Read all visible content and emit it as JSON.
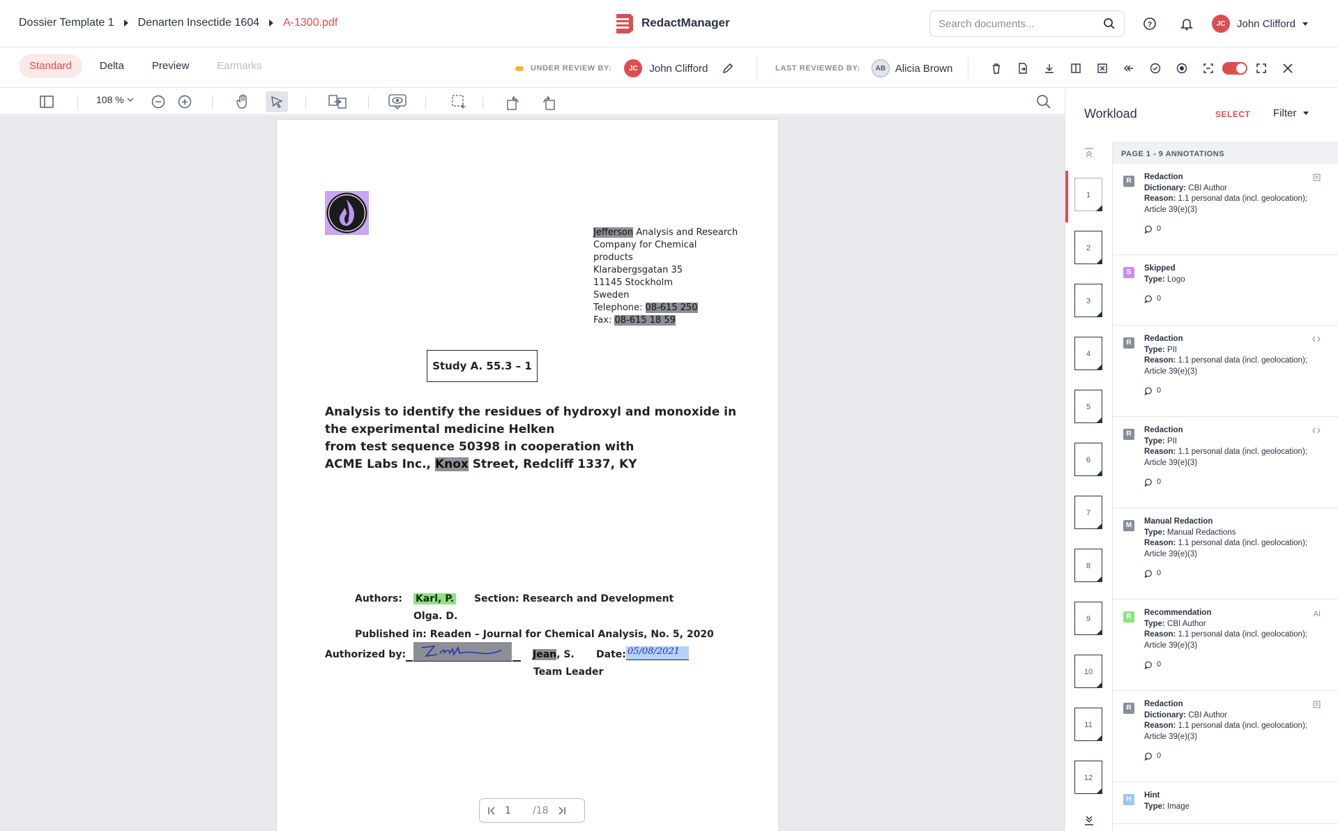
{
  "breadcrumb": {
    "items": [
      "Dossier Template 1",
      "Denarten Insectide 1604"
    ],
    "current_file": "A-1300.pdf"
  },
  "brand": {
    "name": "RedactManager",
    "color": "#dd4d50"
  },
  "search": {
    "placeholder": "Search documents..."
  },
  "user": {
    "initials": "JC",
    "name": "John Clifford"
  },
  "modes": [
    {
      "label": "Standard",
      "state": "active"
    },
    {
      "label": "Delta",
      "state": "normal"
    },
    {
      "label": "Preview",
      "state": "normal"
    },
    {
      "label": "Earmarks",
      "state": "disabled"
    }
  ],
  "review": {
    "under_review_label": "UNDER REVIEW BY:",
    "reviewer_initials": "JC",
    "reviewer": "John Clifford",
    "last_reviewed_label": "LAST REVIEWED BY:",
    "last_reviewer_initials": "AB",
    "last_reviewer": "Alicia Brown"
  },
  "viewer": {
    "zoom": "108 %",
    "page_current": "1",
    "page_total": "/18"
  },
  "document": {
    "address_lines": [
      {
        "pre": "",
        "hl": "Jefferson",
        "post": " Analysis and Research"
      },
      {
        "pre": "Company for Chemical",
        "hl": "",
        "post": ""
      },
      {
        "pre": "products",
        "hl": "",
        "post": ""
      },
      {
        "pre": "Klarabergsgatan 35",
        "hl": "",
        "post": ""
      },
      {
        "pre": "11145 Stockholm",
        "hl": "",
        "post": ""
      },
      {
        "pre": "Sweden",
        "hl": "",
        "post": ""
      },
      {
        "pre": "Telephone: ",
        "hl": "08-615 250",
        "post": ""
      },
      {
        "pre": "Fax: ",
        "hl": "08-615 18 59",
        "post": ""
      }
    ],
    "study": "Study A. 55.3 – 1",
    "title_lines": [
      "Analysis to identify the residues of hydroxyl and monoxide in",
      "the experimental medicine Helken",
      "from test sequence 50398 in cooperation with"
    ],
    "title_last_pre": "ACME Labs Inc., ",
    "title_last_hl": "Knox",
    "title_last_post": " Street, Redcliff 1337, KY",
    "authors_label": "Authors:",
    "author1": "Karl, P.",
    "section": "Section: Research and Development",
    "author2": "Olga. D.",
    "published": "Published in: Readen – Journal for Chemical Analysis, No. 5, 2020",
    "authorized_label": "Authorized by:",
    "signer_hl": "Jean",
    "signer_post": ", S.",
    "date_label": "Date:",
    "date_value": "05/08/2021",
    "role": "Team Leader"
  },
  "workload": {
    "title": "Workload",
    "select_label": "SELECT",
    "filter_label": "Filter",
    "page_header": "PAGE 1 - 9 ANNOTATIONS",
    "thumbnails": [
      "1",
      "2",
      "3",
      "4",
      "5",
      "6",
      "7",
      "8",
      "9",
      "10",
      "11",
      "12"
    ],
    "annotations": [
      {
        "badge": "R",
        "color": "#868e9a",
        "title": "Redaction",
        "k1": "Dictionary:",
        "v1": " CBI Author",
        "reason": " 1.1 personal data (incl. geolocation); Article 39(e)(3)",
        "comments": "0",
        "corner": "icon"
      },
      {
        "badge": "S",
        "color": "#c98cf5",
        "title": "Skipped",
        "k1": "Type:",
        "v1": " Logo",
        "reason": "",
        "comments": "0",
        "corner": ""
      },
      {
        "badge": "R",
        "color": "#868e9a",
        "title": "Redaction",
        "k1": "Type:",
        "v1": " PII",
        "reason": " 1.1 personal data (incl. geolocation); Article 39(e)(3)",
        "comments": "0",
        "corner": "code"
      },
      {
        "badge": "R",
        "color": "#868e9a",
        "title": "Redaction",
        "k1": "Type:",
        "v1": " PII",
        "reason": " 1.1 personal data (incl. geolocation); Article 39(e)(3)",
        "comments": "0",
        "corner": "code"
      },
      {
        "badge": "M",
        "color": "#868e9a",
        "title": "Manual Redaction",
        "k1": "Type:",
        "v1": " Manual Redactions",
        "reason": " 1.1 personal data (incl. geolocation); Article 39(e)(3)",
        "comments": "0",
        "corner": ""
      },
      {
        "badge": "R",
        "color": "#8ee47c",
        "title": "Recommendation",
        "k1": "Type:",
        "v1": " CBI Author",
        "reason": " 1.1 personal data (incl. geolocation); Article 39(e)(3)",
        "comments": "0",
        "corner": "AI"
      },
      {
        "badge": "R",
        "color": "#868e9a",
        "title": "Redaction",
        "k1": "Dictionary:",
        "v1": " CBI Author",
        "reason": " 1.1 personal data (incl. geolocation); Article 39(e)(3)",
        "comments": "0",
        "corner": "icon"
      },
      {
        "badge": "H",
        "color": "#9fc3f5",
        "title": "Hint",
        "k1": "Type:",
        "v1": " Image",
        "reason": "",
        "comments": "",
        "corner": ""
      }
    ],
    "reason_label": "Reason:"
  },
  "colors": {
    "accent": "#dd4d50",
    "redaction": "#8c8f95",
    "recommendation": "#8ee47c"
  }
}
